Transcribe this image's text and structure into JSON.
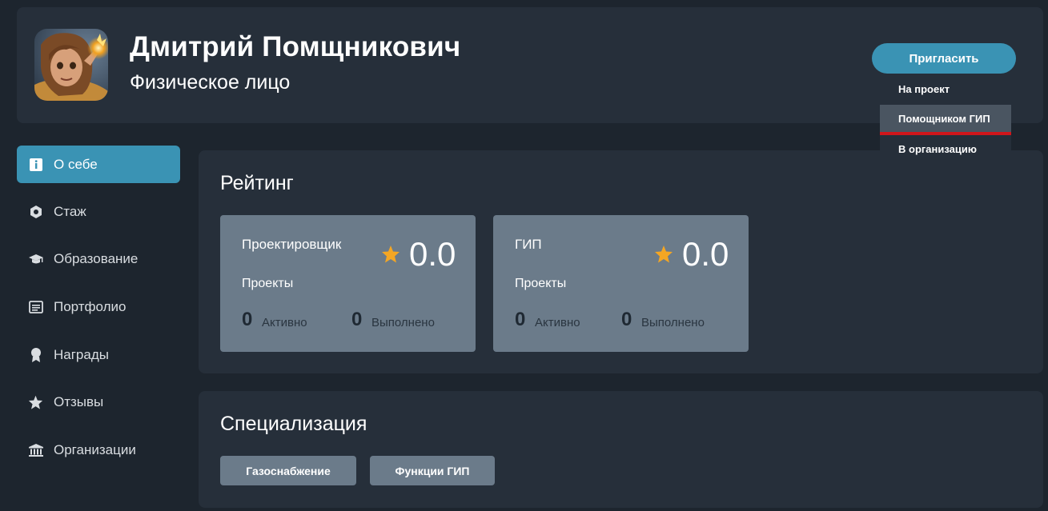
{
  "profile": {
    "name": "Дмитрий Помщникович",
    "type": "Физическое лицо"
  },
  "invite": {
    "label": "Пригласить",
    "menu": [
      {
        "label": "На проект"
      },
      {
        "label": "Помощником ГИП"
      },
      {
        "label": "В организацию"
      }
    ]
  },
  "sidebar": {
    "items": [
      {
        "label": "О себе",
        "icon": "info-icon",
        "active": true
      },
      {
        "label": "Стаж",
        "icon": "hexagon-icon"
      },
      {
        "label": "Образование",
        "icon": "graduation-cap-icon"
      },
      {
        "label": "Портфолио",
        "icon": "portfolio-icon"
      },
      {
        "label": "Награды",
        "icon": "award-icon"
      },
      {
        "label": "Отзывы",
        "icon": "star-icon"
      },
      {
        "label": "Организации",
        "icon": "institution-icon"
      }
    ]
  },
  "rating": {
    "title": "Рейтинг",
    "cards": [
      {
        "role": "Проектировщик",
        "score": "0.0",
        "projects_label": "Проекты",
        "active_count": "0",
        "active_label": "Активно",
        "done_count": "0",
        "done_label": "Выполнено"
      },
      {
        "role": "ГИП",
        "score": "0.0",
        "projects_label": "Проекты",
        "active_count": "0",
        "active_label": "Активно",
        "done_count": "0",
        "done_label": "Выполнено"
      }
    ]
  },
  "specialization": {
    "title": "Специализация",
    "tags": [
      "Газоснабжение",
      "Функции ГИП"
    ]
  },
  "colors": {
    "accent": "#3a93b4",
    "star": "#f4a623",
    "highlight_underline": "#d0161b"
  }
}
